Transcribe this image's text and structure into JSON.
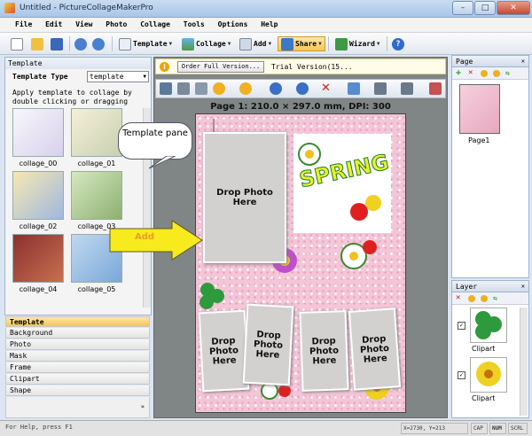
{
  "window": {
    "title": "Untitled - PictureCollageMakerPro",
    "min": "–",
    "max": "□",
    "close": "✕"
  },
  "menu": [
    "File",
    "Edit",
    "View",
    "Photo",
    "Collage",
    "Tools",
    "Options",
    "Help"
  ],
  "toolbar": {
    "template": "Template",
    "collage": "Collage",
    "add": "Add",
    "share": "Share",
    "wizard": "Wizard",
    "help": "?"
  },
  "left_panel": {
    "title": "Template",
    "type_label": "Template Type",
    "type_value": "template",
    "hint": "Apply template to collage by double clicking or dragging",
    "thumbs": [
      "collage_00",
      "collage_01",
      "collage_02",
      "collage_03",
      "collage_04",
      "collage_05"
    ],
    "tabs": [
      "Template",
      "Background",
      "Photo",
      "Mask",
      "Frame",
      "Clipart",
      "Shape"
    ]
  },
  "notice": {
    "order_button": "Order Full Version...",
    "trial": "Trial Version(15..."
  },
  "canvas": {
    "page_info": "Page 1: 210.0 × 297.0 mm, DPI: 300",
    "drop": "Drop Photo Here",
    "spring": "SPRING"
  },
  "callouts": {
    "template_pane": "Template pane",
    "add": "Add"
  },
  "page_panel": {
    "title": "Page",
    "item": "Page1"
  },
  "layer_panel": {
    "title": "Layer",
    "items": [
      "Clipart",
      "Clipart"
    ]
  },
  "status": {
    "help": "For Help, press F1",
    "coords": "X=2730, Y=213",
    "cap": "CAP",
    "num": "NUM",
    "scrl": "SCRL"
  },
  "colors": {
    "accent": "#f5c55a",
    "canvas_bg": "#f3c6d8",
    "arrow": "#f7ea1d"
  }
}
